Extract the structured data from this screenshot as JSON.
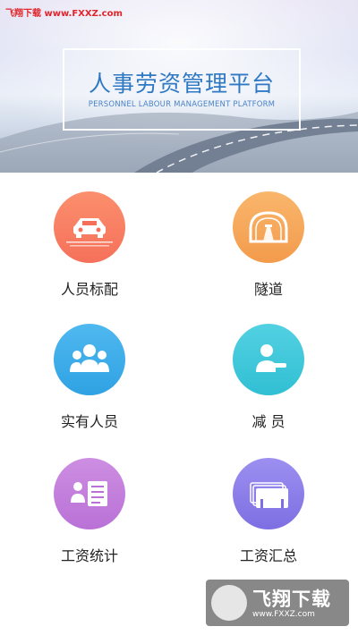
{
  "banner": {
    "watermark": "飞翔下载 www.FXXZ.com",
    "title": "人事劳资管理平台",
    "subtitle": "PERSONNEL LABOUR MANAGEMENT PLATFORM"
  },
  "menu": {
    "items": [
      {
        "label": "人员标配",
        "icon": "car-icon",
        "color": "#f5705a"
      },
      {
        "label": "隧道",
        "icon": "tunnel-icon",
        "color": "#f39b4c"
      },
      {
        "label": "实有人员",
        "icon": "people-group-icon",
        "color": "#2fa2e3"
      },
      {
        "label": "减 员",
        "icon": "person-minus-icon",
        "color": "#31bfd3"
      },
      {
        "label": "工资统计",
        "icon": "salary-list-icon",
        "color": "#b971d6"
      },
      {
        "label": "工资汇总",
        "icon": "summary-boards-icon",
        "color": "#7d6fe2"
      }
    ]
  },
  "watermark": {
    "brand": "飞翔下载",
    "url": "www.FXXZ.com"
  }
}
